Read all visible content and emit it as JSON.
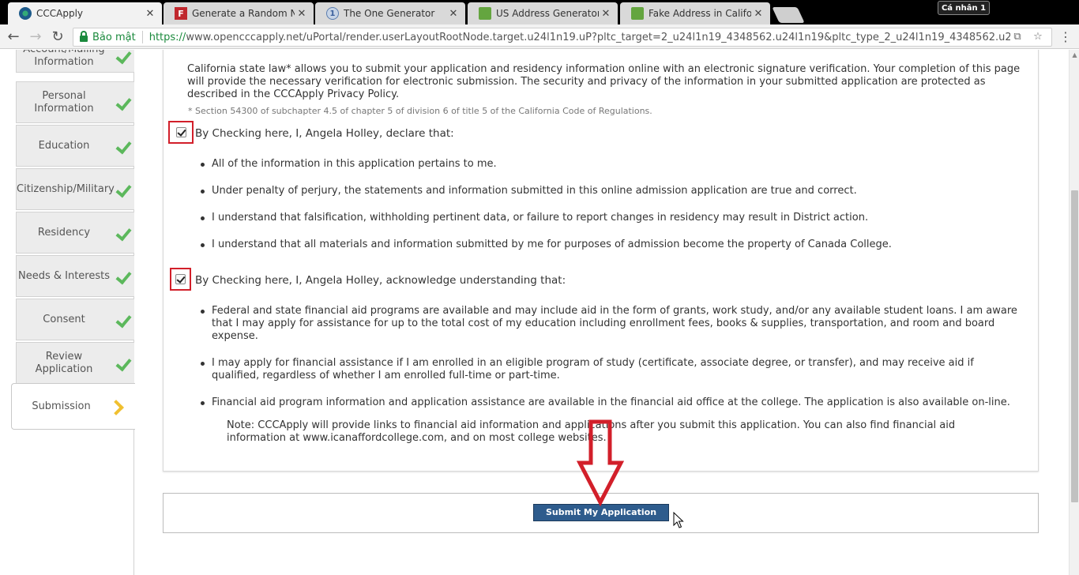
{
  "browser": {
    "tabs": [
      {
        "title": "CCCApply",
        "active": true
      },
      {
        "title": "Generate a Random Name",
        "active": false
      },
      {
        "title": "The One Generator",
        "active": false
      },
      {
        "title": "US Address Generator - F",
        "active": false
      },
      {
        "title": "Fake Address in California",
        "active": false
      }
    ],
    "profile_label": "Cá nhân 1",
    "secure_label": "Bảo mật",
    "url_protocol": "https://",
    "url_rest": "www.opencccapply.net/uPortal/render.userLayoutRootNode.target.u24l1n19.uP?pltc_target=2_u24l1n19_4348562.u24l1n19&pltc_type_2_u24l1n19_4348562.u24l1n19=R"
  },
  "sidebar": {
    "items": [
      {
        "label": "Account/Mailing Information",
        "status": "complete"
      },
      {
        "label": "Personal Information",
        "status": "complete"
      },
      {
        "label": "Education",
        "status": "complete"
      },
      {
        "label": "Citizenship/Military",
        "status": "complete"
      },
      {
        "label": "Residency",
        "status": "complete"
      },
      {
        "label": "Needs & Interests",
        "status": "complete"
      },
      {
        "label": "Consent",
        "status": "complete"
      },
      {
        "label": "Review Application",
        "status": "complete"
      },
      {
        "label": "Submission",
        "status": "current"
      }
    ]
  },
  "content": {
    "intro": "California state law* allows you to submit your application and residency information online with an electronic signature verification. Your completion of this page will provide the necessary verification for electronic submission. The security and privacy of the information in your submitted application are protected as described in the CCCApply Privacy Policy.",
    "footnote": "* Section 54300 of subchapter 4.5 of chapter 5 of division 6 of title 5 of the California Code of Regulations.",
    "declaration_1": {
      "label": "By Checking here, I, Angela Holley, declare that:",
      "checked": true,
      "bullets": [
        "All of the information in this application pertains to me.",
        "Under penalty of perjury, the statements and information submitted in this online admission application are true and correct.",
        "I understand that falsification, withholding pertinent data, or failure to report changes in residency may result in District action.",
        "I understand that all materials and information submitted by me for purposes of admission become the property of Canada College."
      ]
    },
    "declaration_2": {
      "label": "By Checking here, I, Angela Holley, acknowledge understanding that:",
      "checked": true,
      "bullets": [
        "Federal and state financial aid programs are available and may include aid in the form of grants, work study, and/or any available student loans. I am aware that I may apply for assistance for up to the total cost of my education including enrollment fees, books & supplies, transportation, and room and board expense.",
        "I may apply for financial assistance if I am enrolled in an eligible program of study (certificate, associate degree, or transfer), and may receive aid if qualified, regardless of whether I am enrolled full-time or part-time.",
        "Financial aid program information and application assistance are available in the financial aid office at the college. The application is also available on-line."
      ]
    },
    "note": "Note: CCCApply will provide links to financial aid information and applications after you submit this application. You can also find financial aid information at www.icanaffordcollege.com, and on most college websites."
  },
  "submit": {
    "label": "Submit My Application"
  },
  "colors": {
    "accent_red": "#d21f2a",
    "check_green": "#5cb85c",
    "current_chevron": "#f0c030",
    "button_blue": "#2e5c8d"
  }
}
